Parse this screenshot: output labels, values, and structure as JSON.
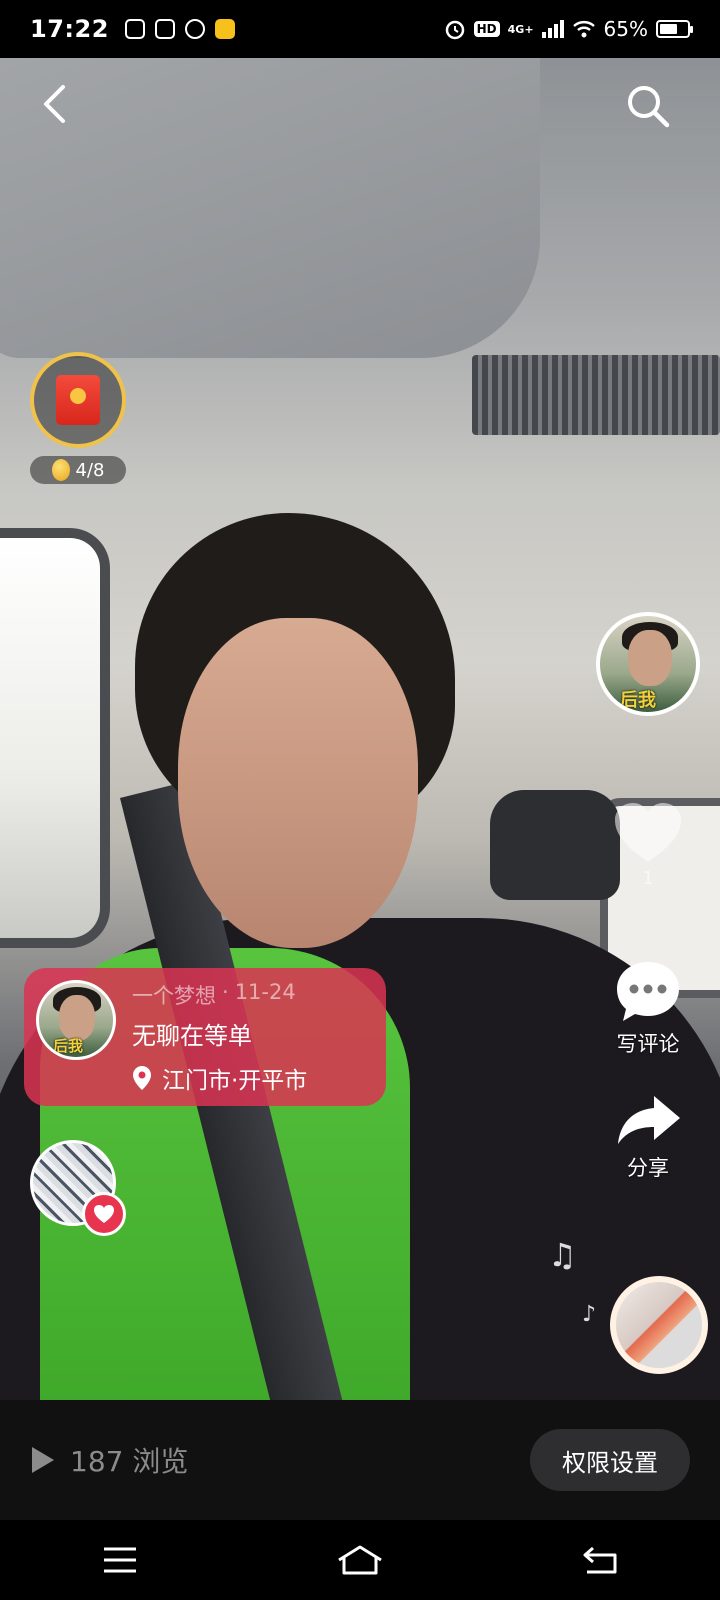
{
  "status_bar": {
    "time": "17:22",
    "battery_percent": "65%",
    "battery_level": 0.65,
    "hd_label": "HD",
    "network_label": "4G+",
    "app_icons": [
      "music-app-icon",
      "photo-app-icon",
      "tiktok-icon",
      "game-app-icon"
    ]
  },
  "top_bar": {
    "back_icon": "chevron-left-icon",
    "search_icon": "search-icon"
  },
  "reward": {
    "icon": "red-envelope-icon",
    "coin_icon": "gold-coin-icon",
    "progress_text": "4/8",
    "ring_color": "#f0c24a"
  },
  "actions": {
    "like_count": "1",
    "comment_label": "写评论",
    "share_label": "分享"
  },
  "post": {
    "author": "一个梦想",
    "date": "11-24",
    "separator": "·",
    "title": "无聊在等单",
    "location": "江门市·开平市",
    "card_color": "#db3452",
    "avatar_caption": "后我"
  },
  "footer": {
    "views_text": "187 浏览",
    "permission_button": "权限设置"
  },
  "nav": {
    "menu_icon": "menu-icon",
    "home_icon": "home-icon",
    "back_icon": "back-arrow-icon"
  }
}
